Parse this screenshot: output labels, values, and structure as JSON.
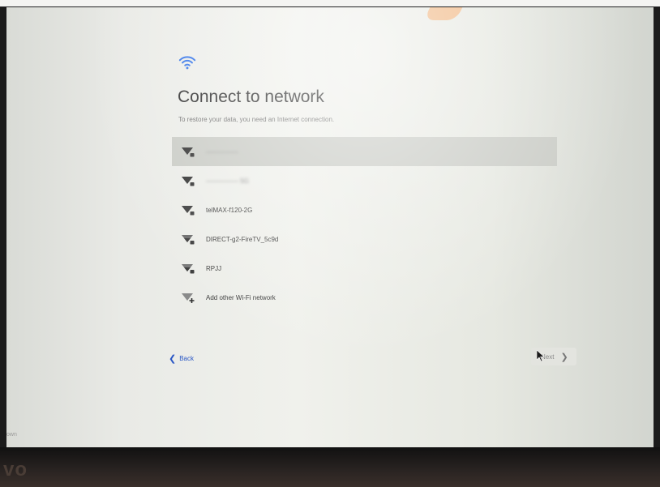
{
  "header": {
    "wifi_icon": "wifi-icon",
    "title": "Connect to network",
    "subtitle": "To restore your data, you need an Internet connection."
  },
  "networks": [
    {
      "label": "—————",
      "icon": "wifi-lock-icon",
      "blurred": true,
      "selected": true
    },
    {
      "label": "————— 5G",
      "icon": "wifi-lock-icon",
      "blurred": true,
      "selected": false
    },
    {
      "label": "telMAX-f120-2G",
      "icon": "wifi-lock-icon",
      "blurred": false,
      "selected": false
    },
    {
      "label": "DIRECT-g2-FireTV_5c9d",
      "icon": "wifi-lock-icon",
      "blurred": false,
      "selected": false
    },
    {
      "label": "RPJJ",
      "icon": "wifi-lock-icon",
      "blurred": false,
      "selected": false
    },
    {
      "label": "Add other Wi-Fi network",
      "icon": "wifi-add-icon",
      "blurred": false,
      "selected": false
    }
  ],
  "footer": {
    "back_label": "Back",
    "next_label": "Next",
    "shutdown_label": "own"
  },
  "bezel": {
    "brand": "vo"
  },
  "colors": {
    "accent": "#2a57c5",
    "title": "#262626",
    "selected_row": "#c9cbc5"
  }
}
